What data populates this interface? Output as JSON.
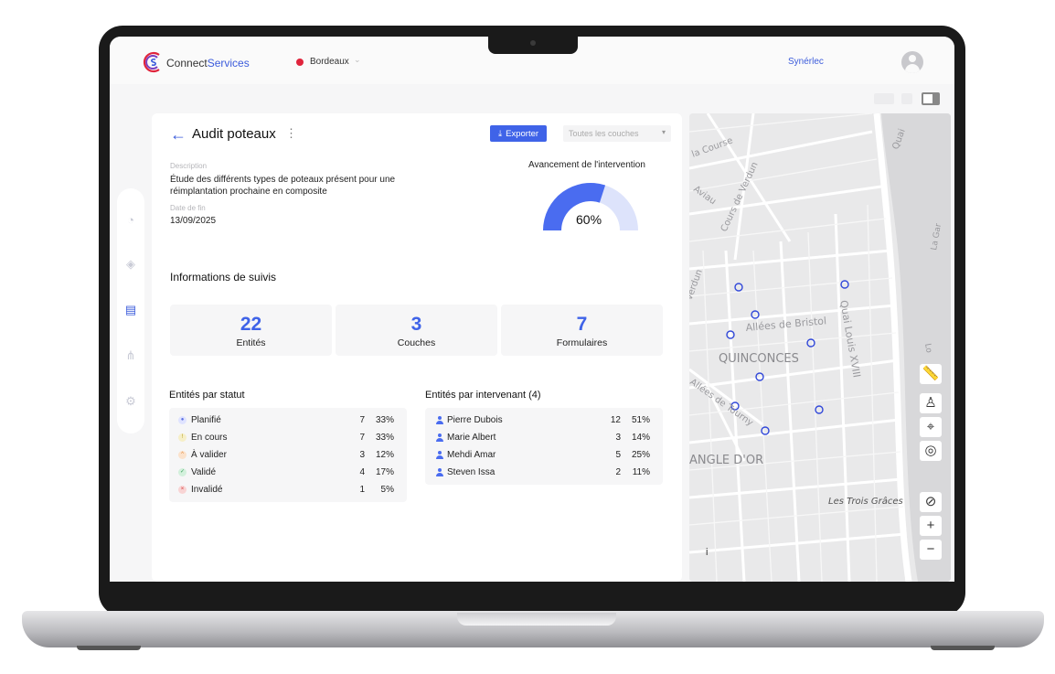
{
  "app": {
    "brand_prefix": "Connect",
    "brand_suffix": "Services",
    "city": "Bordeaux",
    "organization": "Synérlec"
  },
  "intervention": {
    "title": "Audit poteaux",
    "export_label": "Exporter",
    "layers_select": "Toutes les couches",
    "description_label": "Description",
    "description": "Étude des différents types de poteaux présent pour une réimplantation prochaine en composite",
    "date_label": "Date de fin",
    "date": "13/09/2025",
    "progress_title": "Avancement de l'intervention",
    "progress_value": 60,
    "progress_label": "60%"
  },
  "tracking": {
    "section_title": "Informations de suivis",
    "kpis": [
      {
        "value": "22",
        "label": "Entités"
      },
      {
        "value": "3",
        "label": "Couches"
      },
      {
        "value": "7",
        "label": "Formulaires"
      }
    ]
  },
  "status_list": {
    "title": "Entités par statut",
    "rows": [
      {
        "name": "Planifié",
        "count": "7",
        "pct": "33%",
        "color": "#5b6ee1",
        "bg": "#dfe3ff",
        "glyph": "●"
      },
      {
        "name": "En cours",
        "count": "7",
        "pct": "33%",
        "color": "#b39b1a",
        "bg": "#f6efc8",
        "glyph": "!"
      },
      {
        "name": "À valider",
        "count": "3",
        "pct": "12%",
        "color": "#e08a3c",
        "bg": "#fbe2cc",
        "glyph": "^"
      },
      {
        "name": "Validé",
        "count": "4",
        "pct": "17%",
        "color": "#3aa05a",
        "bg": "#d3f0dc",
        "glyph": "✓"
      },
      {
        "name": "Invalidé",
        "count": "1",
        "pct": "5%",
        "color": "#d63b3b",
        "bg": "#f8d4d4",
        "glyph": "×"
      }
    ]
  },
  "people_list": {
    "title": "Entités par intervenant (4)",
    "rows": [
      {
        "name": "Pierre Dubois",
        "count": "12",
        "pct": "51%"
      },
      {
        "name": "Marie Albert",
        "count": "3",
        "pct": "14%"
      },
      {
        "name": "Mehdi Amar",
        "count": "5",
        "pct": "25%"
      },
      {
        "name": "Steven Issa",
        "count": "2",
        "pct": "11%"
      }
    ]
  },
  "map": {
    "labels": {
      "la_course": "la Course",
      "verdun": "Cours de Verdun",
      "aviau": "Aviau",
      "quai": "Quai",
      "la_gar": "La Gar",
      "verdun_short": "Verdun",
      "bristol": "Allées de Bristol",
      "quinconces": "QUINCONCES",
      "quai_louis": "Quai Louis XVIII",
      "lo": "Lo",
      "tourny": "Allées de Tourny",
      "angle": "ANGLE D'OR",
      "graces": "Les Trois Grâces"
    },
    "info": "i",
    "controls": [
      "ruler-icon",
      "person-icon",
      "satellite-icon",
      "locate-icon",
      "compass-icon",
      "zoom-in-icon",
      "zoom-out-icon"
    ]
  }
}
